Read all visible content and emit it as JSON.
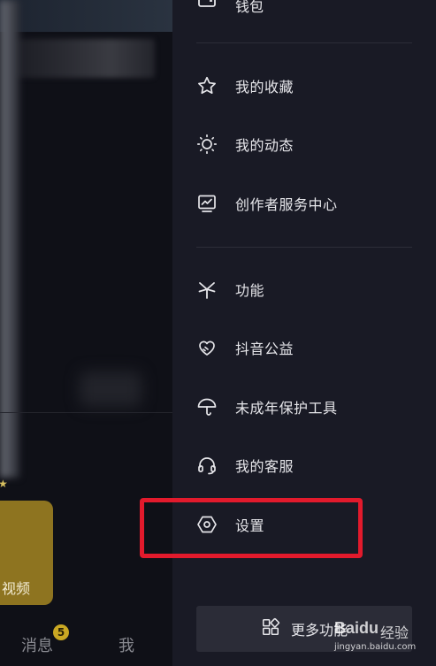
{
  "drawer": {
    "wallet_label": "钱包",
    "items": [
      {
        "label": "我的收藏",
        "icon": "star-icon"
      },
      {
        "label": "我的动态",
        "icon": "sun-icon"
      },
      {
        "label": "创作者服务中心",
        "icon": "chart-monitor-icon"
      },
      {
        "label": "功能",
        "icon": "asterisk-icon"
      },
      {
        "label": "抖音公益",
        "icon": "heart-hands-icon"
      },
      {
        "label": "未成年保护工具",
        "icon": "umbrella-icon"
      },
      {
        "label": "我的客服",
        "icon": "headset-icon"
      },
      {
        "label": "设置",
        "icon": "hexagon-settings-icon"
      }
    ],
    "more_label": "更多功能"
  },
  "background": {
    "video_label": "视频",
    "nav_messages": "消息",
    "nav_messages_badge": "5",
    "nav_me": "我"
  },
  "watermark": {
    "brand": "Baidu",
    "jingyan": "经验",
    "url": "jingyan.baidu.com"
  },
  "colors": {
    "drawer_bg": "#191a25",
    "highlight": "#e21a2c",
    "badge": "#caa823"
  }
}
